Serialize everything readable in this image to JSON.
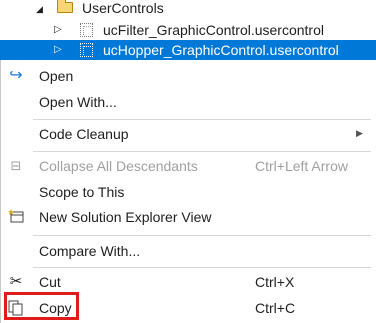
{
  "tree": {
    "folder_label": "UserControls",
    "items": [
      {
        "label": "ucFilter_GraphicControl.usercontrol"
      },
      {
        "label": "ucHopper_GraphicControl.usercontrol"
      }
    ]
  },
  "menu": {
    "open": "Open",
    "open_with": "Open With...",
    "code_cleanup": "Code Cleanup",
    "collapse_all": "Collapse All Descendants",
    "collapse_all_shortcut": "Ctrl+Left Arrow",
    "scope_to_this": "Scope to This",
    "new_view": "New Solution Explorer View",
    "compare_with": "Compare With...",
    "cut": "Cut",
    "cut_shortcut": "Ctrl+X",
    "copy": "Copy",
    "copy_shortcut": "Ctrl+C"
  },
  "colors": {
    "selection": "#0078d7",
    "highlight_box": "#e01b1b",
    "icon_blue": "#1e7bd6"
  }
}
